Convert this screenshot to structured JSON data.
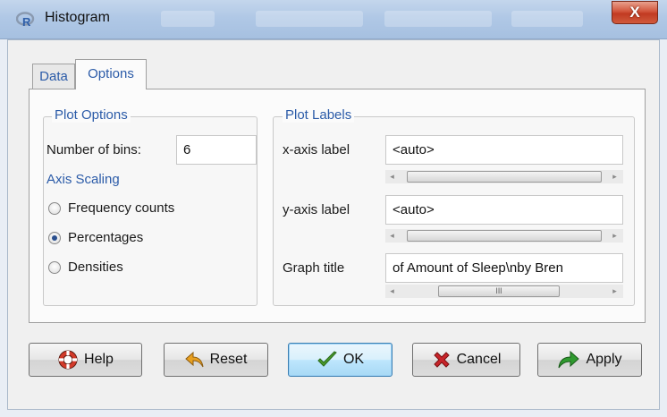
{
  "window": {
    "title": "Histogram",
    "close_glyph": "X",
    "icon": "r-logo-icon"
  },
  "tabs": [
    {
      "label": "Data",
      "active": false
    },
    {
      "label": "Options",
      "active": true
    }
  ],
  "plot_options": {
    "legend": "Plot Options",
    "bins_label": "Number of bins:",
    "bins_value": "6",
    "axis_scaling_label": "Axis Scaling",
    "scaling_options": [
      {
        "label": "Frequency counts",
        "checked": false
      },
      {
        "label": "Percentages",
        "checked": true
      },
      {
        "label": "Densities",
        "checked": false
      }
    ]
  },
  "plot_labels": {
    "legend": "Plot Labels",
    "xlab_label": "x-axis label",
    "xlab_value": "<auto>",
    "ylab_label": "y-axis label",
    "ylab_value": "<auto>",
    "title_label": "Graph title",
    "title_value": "of Amount of Sleep\\nby Bren"
  },
  "buttons": {
    "help": "Help",
    "reset": "Reset",
    "ok": "OK",
    "cancel": "Cancel",
    "apply": "Apply"
  },
  "colors": {
    "accent_blue": "#2b5ba8",
    "close_red": "#c13a22",
    "ok_check_green": "#4a9a2a",
    "cancel_red": "#c8242a",
    "apply_green": "#2f9a2f"
  }
}
